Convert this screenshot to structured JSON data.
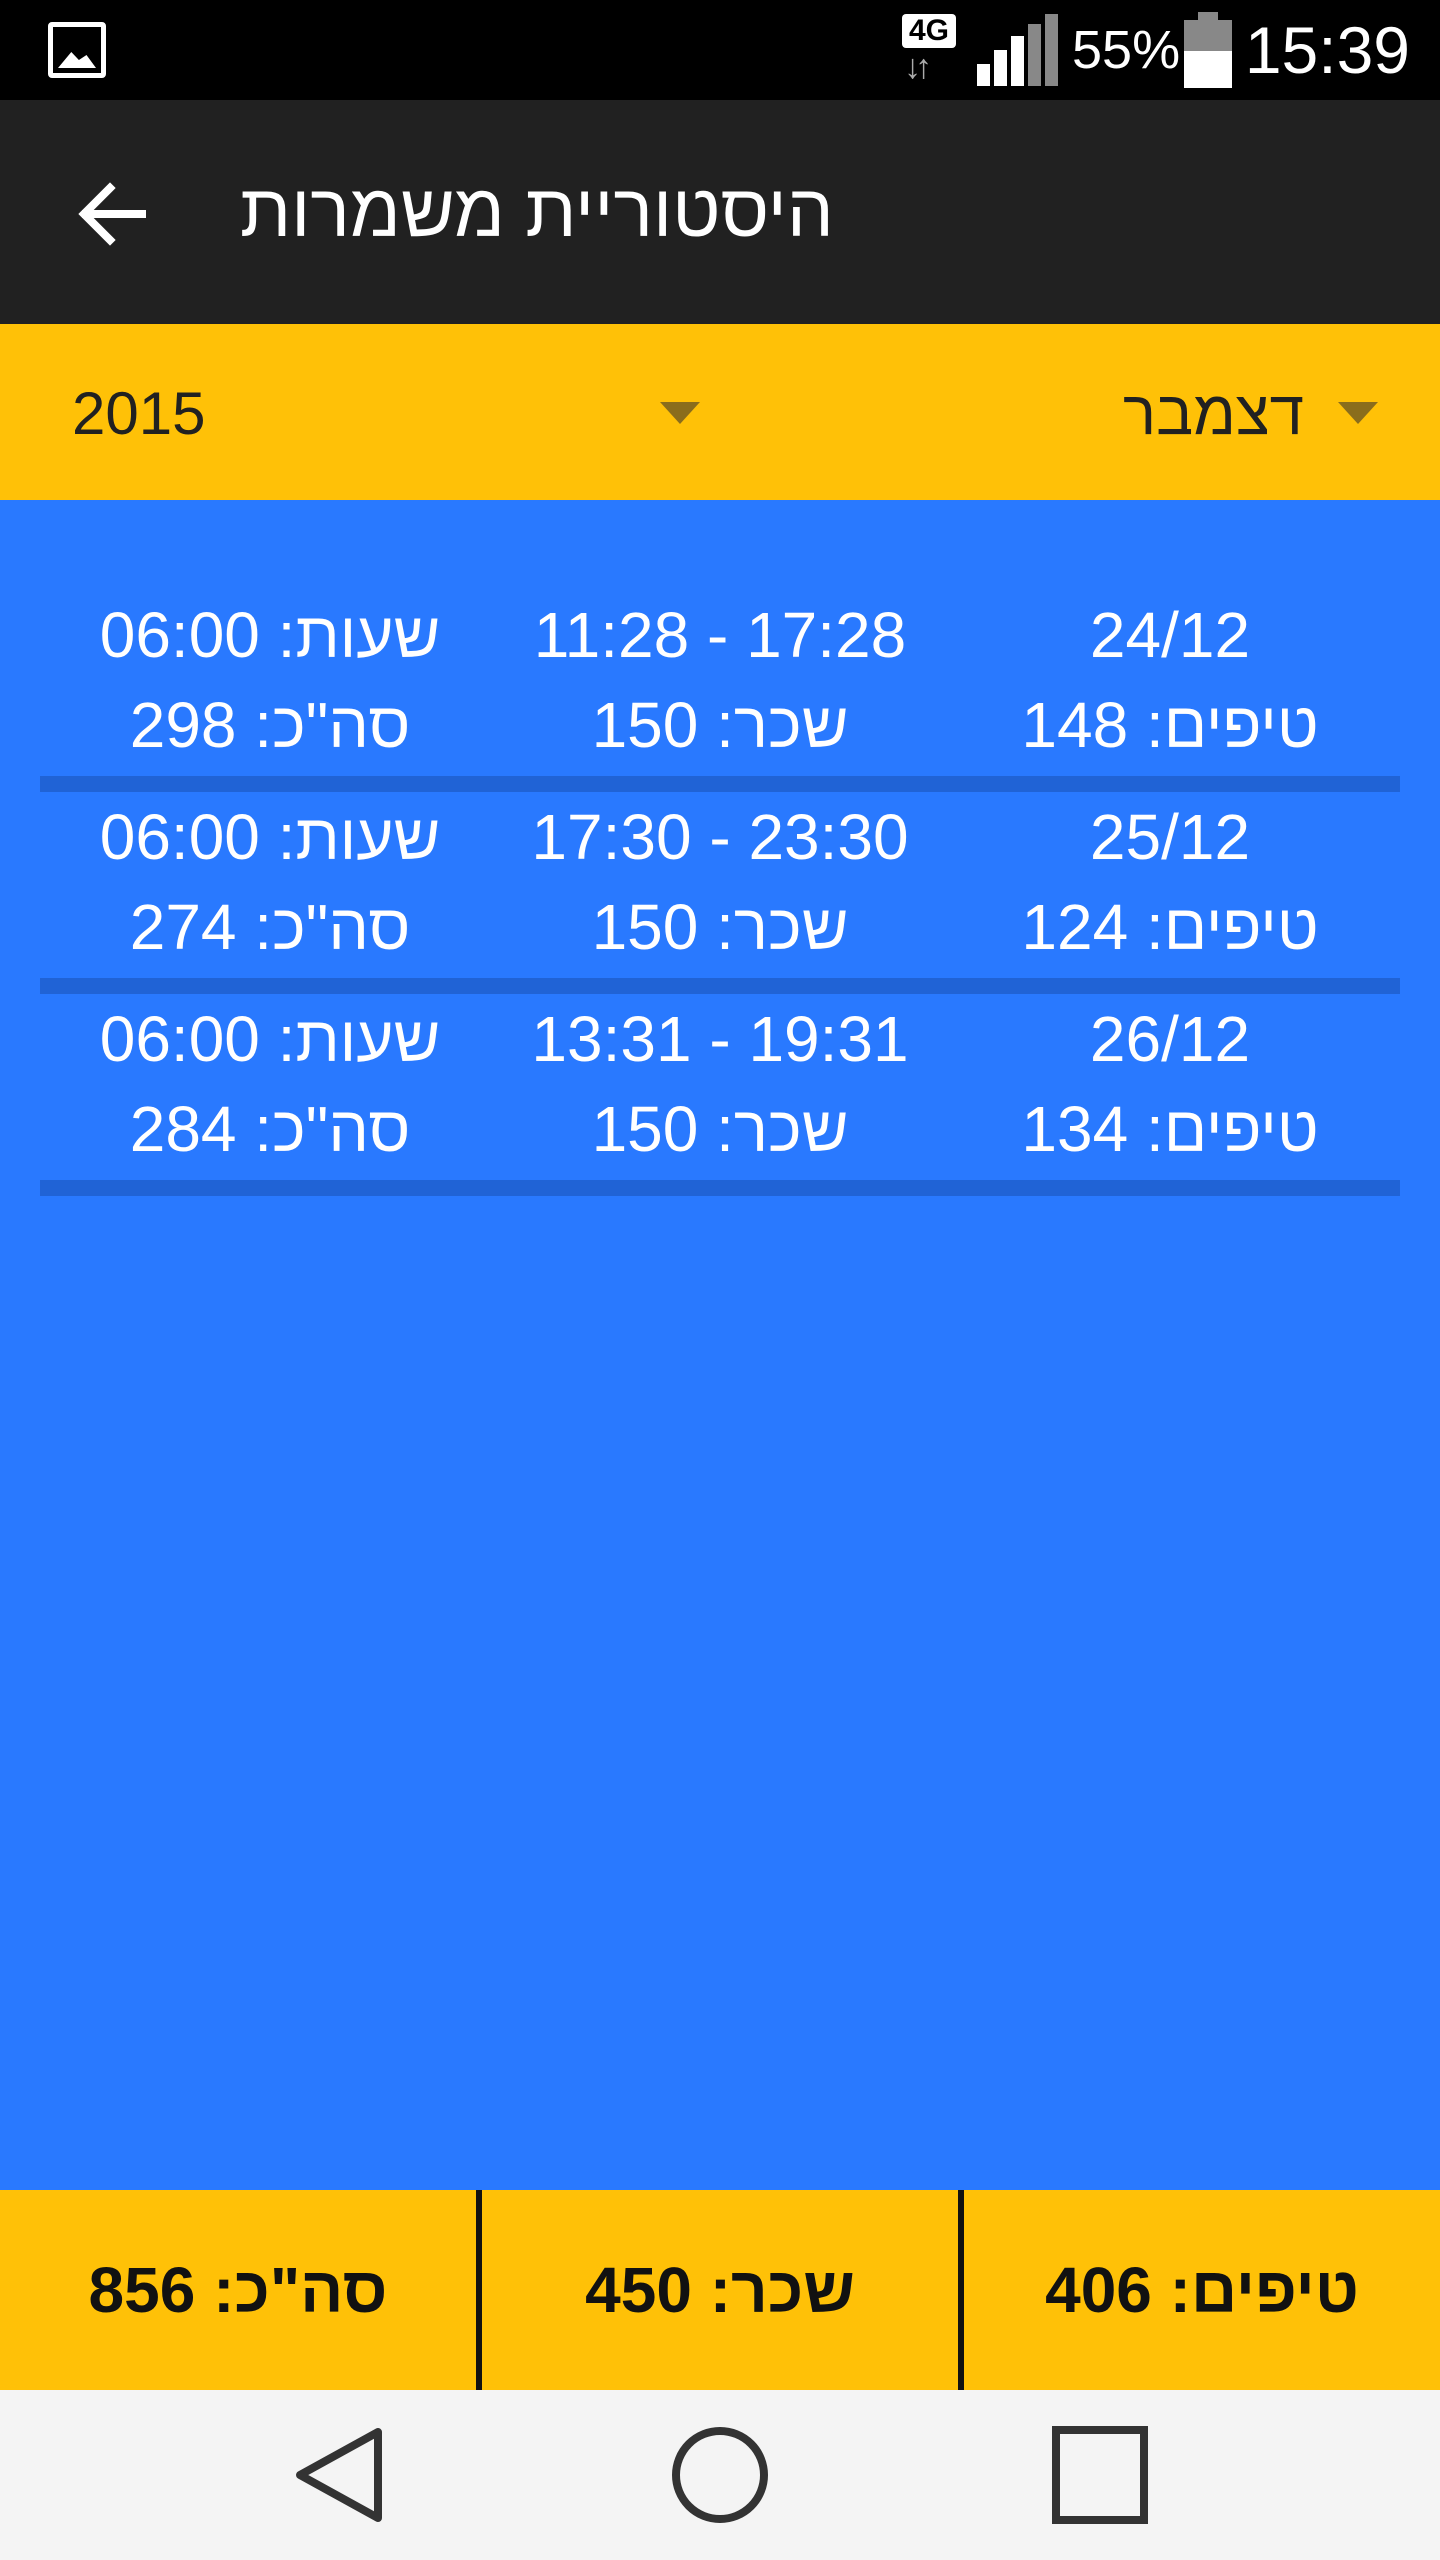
{
  "status_bar": {
    "network": "4G",
    "battery_text": "55%",
    "battery_level": 0.55,
    "time": "15:39",
    "icons": [
      "image-icon",
      "network-4g-icon",
      "signal-icon",
      "battery-icon"
    ]
  },
  "app_bar": {
    "title": "היסטוריית משמרות",
    "back_icon": "arrow-back-icon"
  },
  "filters": {
    "year": "2015",
    "month": "דצמבר"
  },
  "shifts": [
    {
      "date": "24/12",
      "time_range": "11:28 - 17:28",
      "hours": "שעות: 06:00",
      "tips": "טיפים: 148",
      "wage": "שכר: 150",
      "total": "סה\"כ: 298"
    },
    {
      "date": "25/12",
      "time_range": "17:30 - 23:30",
      "hours": "שעות: 06:00",
      "tips": "טיפים: 124",
      "wage": "שכר: 150",
      "total": "סה\"כ: 274"
    },
    {
      "date": "26/12",
      "time_range": "13:31 - 19:31",
      "hours": "שעות: 06:00",
      "tips": "טיפים: 134",
      "wage": "שכר: 150",
      "total": "סה\"כ: 284"
    }
  ],
  "totals": {
    "tips": "טיפים: 406",
    "wage": "שכר: 450",
    "total": "סה\"כ: 856"
  },
  "nav_bar": {
    "icons": [
      "nav-back-icon",
      "nav-home-icon",
      "nav-recents-icon"
    ]
  },
  "colors": {
    "accent": "#ffc107",
    "list_bg": "#2979ff",
    "app_bar": "#212121"
  }
}
